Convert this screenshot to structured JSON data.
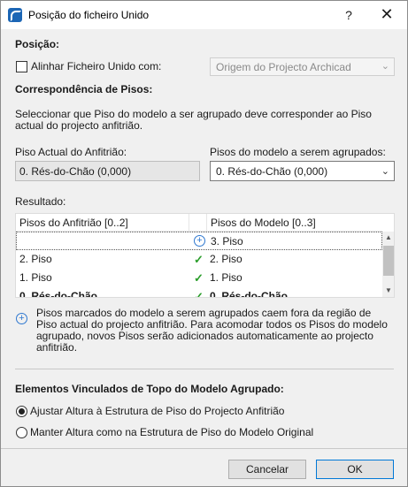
{
  "dialog": {
    "title": "Posição do ficheiro Unido",
    "help": "?",
    "close": "✕"
  },
  "position": {
    "heading": "Posição:",
    "align_label": "Alinhar Ficheiro Unido com:",
    "align_checked": false,
    "align_combo_value": "Origem do Projecto Archicad"
  },
  "stories": {
    "heading": "Correspondência de Pisos:",
    "description": "Seleccionar que Piso do modelo a ser agrupado deve corresponder ao Piso actual do projecto anfitrião.",
    "host_label": "Piso Actual do Anfitrião:",
    "host_value": "0. Rés-do-Chão (0,000)",
    "model_label": "Pisos do modelo a serem agrupados:",
    "model_value": "0. Rés-do-Chão (0,000)"
  },
  "result": {
    "label": "Resultado:",
    "columns": [
      "Pisos do Anfitrião [0..2]",
      "Pisos do Modelo [0..3]"
    ],
    "rows": [
      {
        "host": "",
        "status": "add",
        "model": "3. Piso",
        "bold": false
      },
      {
        "host": "2. Piso",
        "status": "match",
        "model": "2. Piso",
        "bold": false
      },
      {
        "host": "1. Piso",
        "status": "match",
        "model": "1. Piso",
        "bold": false
      },
      {
        "host": "0. Rés-do-Chão",
        "status": "match",
        "model": "0. Rés-do-Chão",
        "bold": true
      }
    ],
    "info": "Pisos marcados do modelo a serem agrupados caem fora da região de Piso actual do projecto anfitrião. Para acomodar todos os Pisos do modelo agrupado, novos Pisos serão adicionados automaticamente ao projecto anfitrião."
  },
  "linked": {
    "heading": "Elementos Vinculados de Topo do Modelo Agrupado:",
    "option1": "Ajustar Altura à Estrutura de Piso do Projecto Anfitrião",
    "option2": "Manter Altura como na Estrutura de Piso do Modelo Original",
    "selected": 1
  },
  "buttons": {
    "cancel": "Cancelar",
    "ok": "OK"
  },
  "colors": {
    "accent": "#2f78d0",
    "check": "#2a9d2a",
    "default_button_border": "#0078d7"
  }
}
